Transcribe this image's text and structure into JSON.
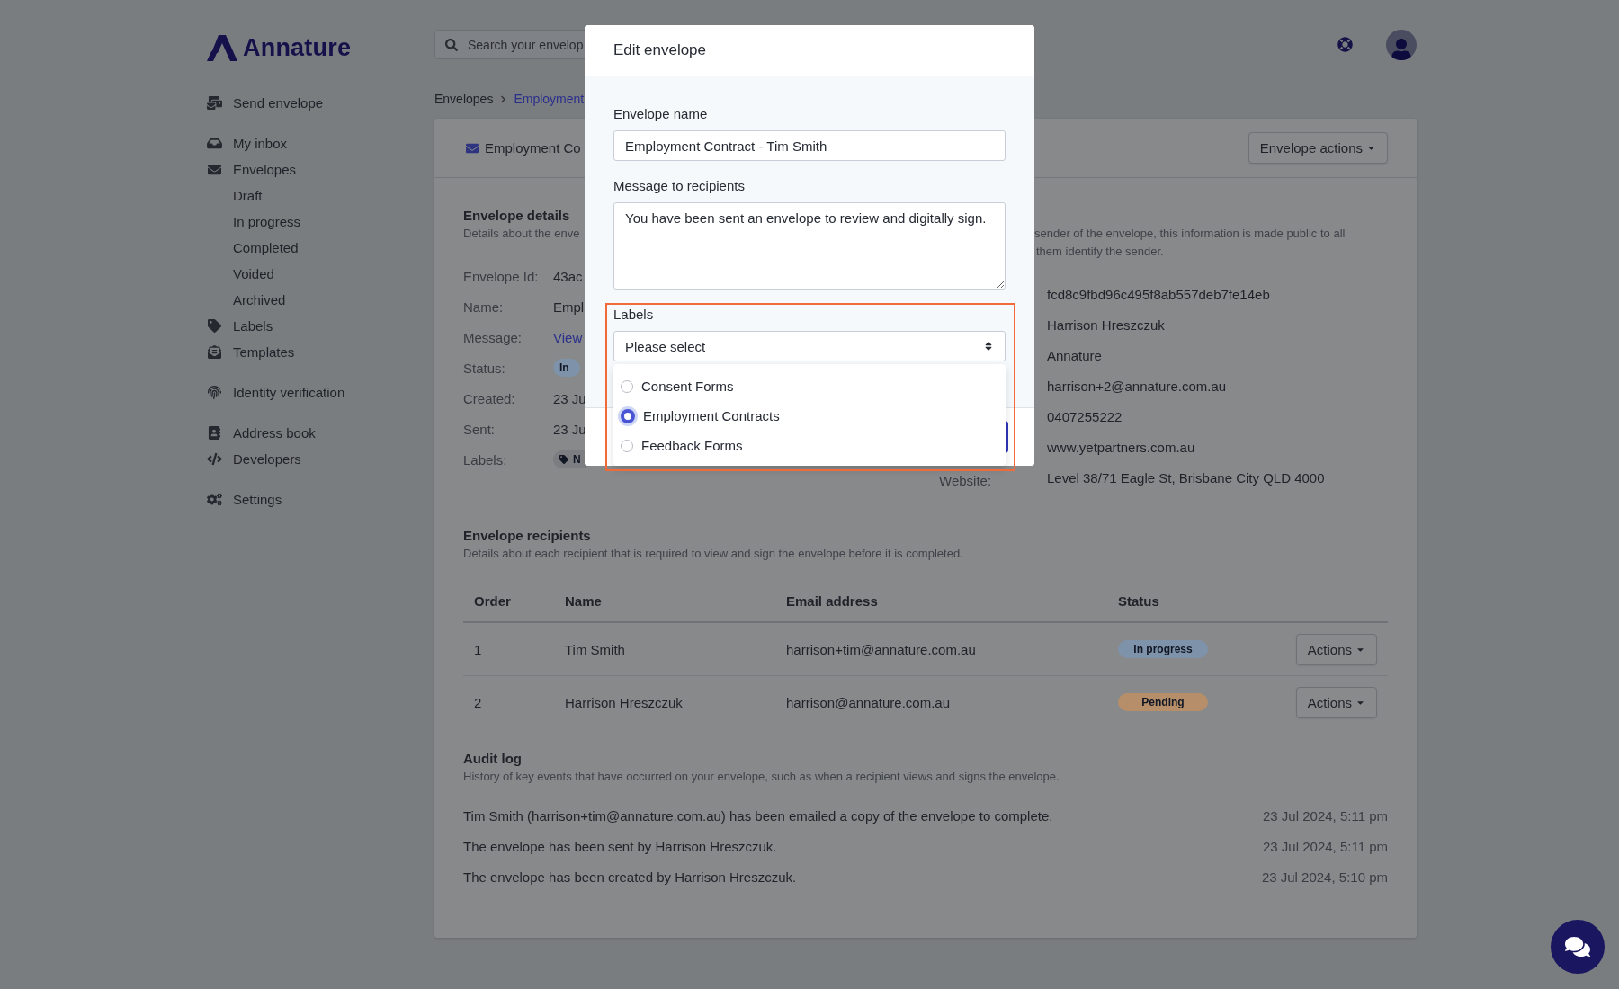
{
  "brand": "Annature",
  "search": {
    "placeholder": "Search your envelop"
  },
  "sidebar": {
    "groups": [
      [
        {
          "label": "Send envelope"
        }
      ],
      [
        {
          "label": "My inbox"
        },
        {
          "label": "Envelopes",
          "children": [
            {
              "label": "Draft"
            },
            {
              "label": "In progress"
            },
            {
              "label": "Completed"
            },
            {
              "label": "Voided"
            },
            {
              "label": "Archived"
            }
          ]
        },
        {
          "label": "Labels"
        },
        {
          "label": "Templates"
        }
      ],
      [
        {
          "label": "Identity verification"
        }
      ],
      [
        {
          "label": "Address book"
        },
        {
          "label": "Developers"
        }
      ],
      [
        {
          "label": "Settings"
        }
      ]
    ]
  },
  "breadcrumb": [
    {
      "label": "Envelopes",
      "kind": "text"
    },
    {
      "label": "Employment",
      "kind": "link"
    }
  ],
  "card": {
    "title": "Employment Co",
    "actions_button": "Envelope actions"
  },
  "details": {
    "title": "Envelope details",
    "description": "Details about the enve",
    "rows": [
      {
        "label": "Envelope Id:",
        "value": "43ac",
        "kind": "text"
      },
      {
        "label": "Name:",
        "value": "Empl",
        "kind": "text"
      },
      {
        "label": "Message:",
        "value": "View",
        "kind": "link"
      },
      {
        "label": "Status:",
        "value": "In",
        "kind": "badge"
      },
      {
        "label": "Created:",
        "value": "23 Ju",
        "kind": "text"
      },
      {
        "label": "Sent:",
        "value": "23 Ju",
        "kind": "text"
      },
      {
        "label": "Labels:",
        "value": "N",
        "kind": "tag"
      }
    ]
  },
  "sender": {
    "description_lines": [
      "sender of the envelope, this information is made public to all",
      "them identify the sender."
    ],
    "rows": [
      {
        "value": "fcd8c9fbd96c495f8ab557deb7fe14eb"
      },
      {
        "value": "Harrison Hreszczuk"
      },
      {
        "value": "Annature"
      },
      {
        "value": "harrison+2@annature.com.au"
      },
      {
        "value": "0407255222"
      },
      {
        "value": "www.yetpartners.com.au"
      },
      {
        "label": "Website:",
        "value": "Level 38/71 Eagle St, Brisbane City QLD 4000"
      }
    ]
  },
  "recipients": {
    "title": "Envelope recipients",
    "description": "Details about each recipient that is required to view and sign the envelope before it is completed.",
    "columns": [
      "Order",
      "Name",
      "Email address",
      "Status"
    ],
    "rows": [
      {
        "order": "1",
        "name": "Tim Smith",
        "email": "harrison+tim@annature.com.au",
        "status": {
          "label": "In progress",
          "color": "#7e93a9"
        },
        "action": "Actions"
      },
      {
        "order": "2",
        "name": "Harrison Hreszczuk",
        "email": "harrison@annature.com.au",
        "status": {
          "label": "Pending",
          "color": "#b68f6a"
        },
        "action": "Actions"
      }
    ]
  },
  "audit_log": {
    "title": "Audit log",
    "description": "History of key events that have occurred on your envelope, such as when a recipient views and signs the envelope.",
    "entries": [
      {
        "text": "Tim Smith (harrison+tim@annature.com.au) has been emailed a copy of the envelope to complete.",
        "time": "23 Jul 2024, 5:11 pm"
      },
      {
        "text": "The envelope has been sent by Harrison Hreszczuk.",
        "time": "23 Jul 2024, 5:11 pm"
      },
      {
        "text": "The envelope has been created by Harrison Hreszczuk.",
        "time": "23 Jul 2024, 5:10 pm"
      }
    ]
  },
  "modal": {
    "title": "Edit envelope",
    "fields": [
      {
        "kind": "input",
        "label": "Envelope name",
        "value": "Employment Contract - Tim Smith"
      },
      {
        "kind": "textarea",
        "label": "Message to recipients",
        "value": "You have been sent an envelope to review and digitally sign."
      },
      {
        "kind": "select",
        "label": "Labels",
        "value": "Please select",
        "highlighted": true
      }
    ],
    "options": [
      {
        "label": "Consent Forms",
        "selected": false
      },
      {
        "label": "Employment Contracts",
        "selected": true
      },
      {
        "label": "Feedback Forms",
        "selected": false
      }
    ]
  }
}
